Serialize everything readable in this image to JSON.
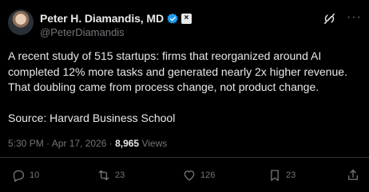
{
  "author": {
    "name": "Peter H. Diamandis, MD",
    "handle": "@PeterDiamandis",
    "affiliate_badge": "×"
  },
  "post": {
    "text": "A recent study of 515 startups: firms that reorganized around AI completed 12% more tasks and generated nearly 2x higher revenue. That doubling came from process change, not product change.\n\nSource: Harvard Business School",
    "time": "5:30 PM · Apr 17, 2026 · ",
    "views_count": "8,965",
    "views_label": " Views"
  },
  "actions": {
    "replies": "10",
    "reposts": "23",
    "likes": "126",
    "bookmarks": "23"
  },
  "colors": {
    "background": "#000000",
    "text": "#e7e9ea",
    "secondary": "#71767b",
    "verified": "#1d9bf0",
    "divider": "#2f3336"
  },
  "icons": [
    "verified-badge-icon",
    "grok-icon",
    "more-icon",
    "reply-icon",
    "repost-icon",
    "like-icon",
    "bookmark-icon",
    "share-icon"
  ]
}
